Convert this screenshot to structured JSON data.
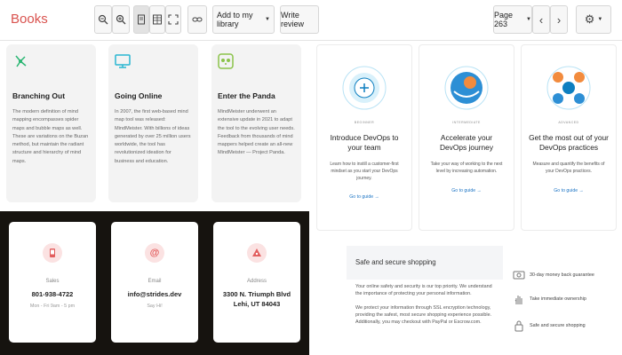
{
  "toolbar": {
    "brand": "Books",
    "add_to_library": "Add to my library",
    "write_review": "Write review",
    "page": "Page 263"
  },
  "mindmap_cards": [
    {
      "title": "Branching Out",
      "body": "The modern definition of mind mapping encompasses spider maps and bubble maps as well. These are variations on the Buzan method, but maintain the radiant structure and hierarchy of mind maps.",
      "icon": "branching-icon",
      "color": "#2bb673"
    },
    {
      "title": "Going Online",
      "body": "In 2007, the first web-based mind map tool was released: MindMeister. With billions of ideas generated by over 25 million users worldwide, the tool has revolutionized ideation for business and education.",
      "icon": "monitor-icon",
      "color": "#29b6d1"
    },
    {
      "title": "Enter the Panda",
      "body": "MindMeister underwent an extensive update in 2021 to adapt the tool to the evolving user needs. Feedback from thousands of mind mappers helped create an all-new MindMeister — Project Panda.",
      "icon": "panda-icon",
      "color": "#8bc34a"
    }
  ],
  "devops_cards": [
    {
      "kicker": "BEGINNER",
      "title": "Introduce DevOps to your team",
      "body": "Learn how to instill a customer-first mindset as you start your DevOps journey.",
      "link": "Go to guide →"
    },
    {
      "kicker": "INTERMEDIATE",
      "title": "Accelerate your DevOps journey",
      "body": "Take your way of working to the next level by increasing automation.",
      "link": "Go to guide →"
    },
    {
      "kicker": "ADVANCED",
      "title": "Get the most out of your DevOps practices",
      "body": "Measure and quantify the benefits of your DevOps practices.",
      "link": "Go to guide →"
    }
  ],
  "contact_cards": [
    {
      "label": "Sales",
      "value": "801-938-4722",
      "sub": "Mon - Fri 9am - 5 pm",
      "icon": "phone-icon"
    },
    {
      "label": "Email",
      "value": "info@strides.dev",
      "sub": "Say Hi!",
      "icon": "at-sign-icon"
    },
    {
      "label": "Address",
      "value": "3300 N. Triumph Blvd\nLehi, UT 84043",
      "sub": "",
      "icon": "map-pin-icon"
    }
  ],
  "shopping": {
    "heading": "Safe and secure shopping",
    "p1": "Your online safety and security is our top priority. We understand the importance of protecting your personal information.",
    "p2": "We protect your information through SSL encryption technology, providing the safest, most secure shopping experience possible. Additionally, you may checkout with PayPal or Escrow.com."
  },
  "features": [
    {
      "text": "30-day money back guarantee",
      "icon": "money-back-icon"
    },
    {
      "text": "Take immediate ownership",
      "icon": "hand-icon"
    },
    {
      "text": "Safe and secure shopping",
      "icon": "lock-icon"
    }
  ]
}
